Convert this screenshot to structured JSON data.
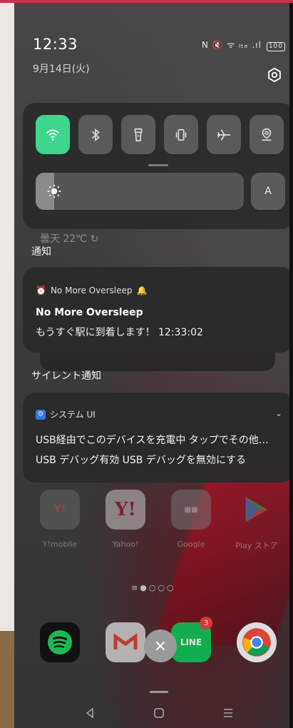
{
  "status_bar": {
    "time": "12:33",
    "date": "9月14日(火)",
    "indicators": "N 🔇 ᯤ ₗₜₑ .ıl",
    "battery": "100"
  },
  "quick_settings": {
    "tiles": [
      {
        "icon": "wifi-icon",
        "active": true
      },
      {
        "icon": "bluetooth-icon",
        "active": false
      },
      {
        "icon": "flashlight-icon",
        "active": false
      },
      {
        "icon": "vibrate-icon",
        "active": false
      },
      {
        "icon": "airplane-icon",
        "active": false
      },
      {
        "icon": "location-icon",
        "active": false
      }
    ],
    "brightness_level": 0.09,
    "auto_brightness_label": "A"
  },
  "weather_text": "曇天 22℃",
  "section_notifications": "通知",
  "alarm_notification": {
    "app_name": "No More Oversleep",
    "title": "No More Oversleep",
    "body": "もうすぐ駅に到着します！ 12:33:02"
  },
  "section_silent": "サイレント通知",
  "system_notification": {
    "app_name": "システム UI",
    "line1": "USB経由でこのデバイスを充電中 タップでその他…",
    "line2": "USB デバッグ有効 USB デバッグを無効にする"
  },
  "home_apps": [
    {
      "label": "Y!mobile"
    },
    {
      "label": "Yahoo!"
    },
    {
      "label": "Google"
    },
    {
      "label": "Play ストア"
    }
  ],
  "dock": {
    "line_badge": "3",
    "close_label": "×"
  },
  "colors": {
    "accent_green": "#3dd68c",
    "panel_bg": "#2c2c2c"
  }
}
